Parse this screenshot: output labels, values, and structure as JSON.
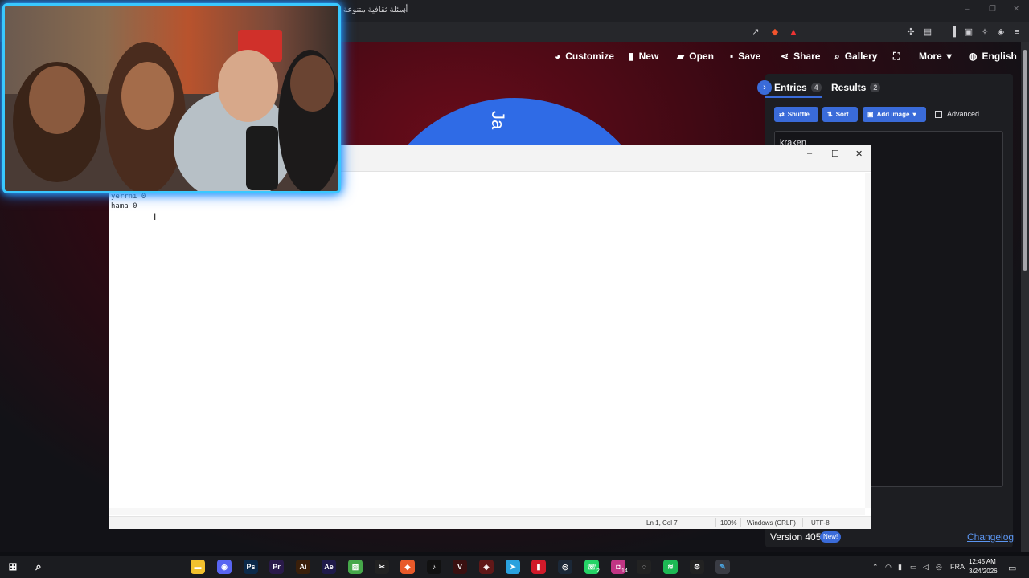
{
  "browser": {
    "tab_title": "أسئلة ثقافية متنوعة",
    "new_tab_glyph": "+",
    "window_controls": [
      "–",
      "❐",
      "✕"
    ]
  },
  "site_nav": [
    {
      "label": "Customize",
      "icon": "palette-icon"
    },
    {
      "label": "New",
      "icon": "file-icon"
    },
    {
      "label": "Open",
      "icon": "folder-open-icon"
    },
    {
      "label": "Save",
      "icon": "save-icon"
    },
    {
      "label": "Share",
      "icon": "share-icon"
    },
    {
      "label": "Gallery",
      "icon": "search-icon"
    },
    {
      "label": "",
      "icon": "fullscreen-icon"
    },
    {
      "label": "More",
      "icon": "chevron-down-icon"
    },
    {
      "label": "English",
      "icon": "globe-icon"
    }
  ],
  "wheel": {
    "visible_text": "Ja",
    "color": "#2f6be6"
  },
  "panel": {
    "tabs": [
      {
        "label": "Entries",
        "count": "4"
      },
      {
        "label": "Results",
        "count": "2"
      }
    ],
    "buttons": {
      "shuffle": "Shuffle",
      "sort": "Sort",
      "add_image": "Add image"
    },
    "advanced_label": "Advanced",
    "entries_visible": "kraken",
    "version": "Version 405",
    "new_badge": "New!",
    "changelog": "Changelog"
  },
  "notepad": {
    "lines": [
      "yerrni 0",
      "hama 0"
    ],
    "status": {
      "position": "Ln 1, Col 7",
      "zoom": "100%",
      "line_endings": "Windows (CRLF)",
      "encoding": "UTF-8"
    },
    "controls": [
      "–",
      "☐",
      "✕"
    ]
  },
  "taskbar": {
    "apps": [
      {
        "name": "file-explorer-icon",
        "glyph": "▬",
        "color": "#f2c12e"
      },
      {
        "name": "discord-icon",
        "glyph": "◉",
        "color": "#5865f2"
      },
      {
        "name": "photoshop-icon",
        "glyph": "Ps",
        "color": "#0b2a4a"
      },
      {
        "name": "premiere-icon",
        "glyph": "Pr",
        "color": "#2a1a4a"
      },
      {
        "name": "illustrator-icon",
        "glyph": "Ai",
        "color": "#3a1f0a"
      },
      {
        "name": "after-effects-icon",
        "glyph": "Ae",
        "color": "#1f1a4a"
      },
      {
        "name": "app-green-icon",
        "glyph": "▨",
        "color": "#46a84a"
      },
      {
        "name": "capcut-icon",
        "glyph": "✂",
        "color": "#222222"
      },
      {
        "name": "brave-icon",
        "glyph": "◆",
        "color": "#e85a2a"
      },
      {
        "name": "tiktok-icon",
        "glyph": "♪",
        "color": "#111111"
      },
      {
        "name": "app-red-icon",
        "glyph": "V",
        "color": "#3a1010"
      },
      {
        "name": "app-game-icon",
        "glyph": "◈",
        "color": "#601818"
      },
      {
        "name": "telegram-icon",
        "glyph": "➤",
        "color": "#2aa1de"
      },
      {
        "name": "app-flag-icon",
        "glyph": "▮",
        "color": "#d11a2a"
      },
      {
        "name": "steam-icon",
        "glyph": "◎",
        "color": "#1b2838"
      },
      {
        "name": "whatsapp-icon",
        "glyph": "☏",
        "color": "#25d366"
      },
      {
        "name": "instagram-icon",
        "glyph": "◘",
        "color": "#c13584"
      },
      {
        "name": "app-circle-icon",
        "glyph": "◌",
        "color": "#222222"
      },
      {
        "name": "spotify-icon",
        "glyph": "≋",
        "color": "#1db954"
      },
      {
        "name": "settings-icon",
        "glyph": "⚙",
        "color": "#222222"
      },
      {
        "name": "notepad-icon",
        "glyph": "✎",
        "color": "#4aa3df"
      }
    ],
    "badges": {
      "whatsapp": "2",
      "instagram": "14"
    },
    "tray": {
      "lang": "FRA",
      "time": "12:45 AM",
      "date": "3/24/2026"
    }
  }
}
